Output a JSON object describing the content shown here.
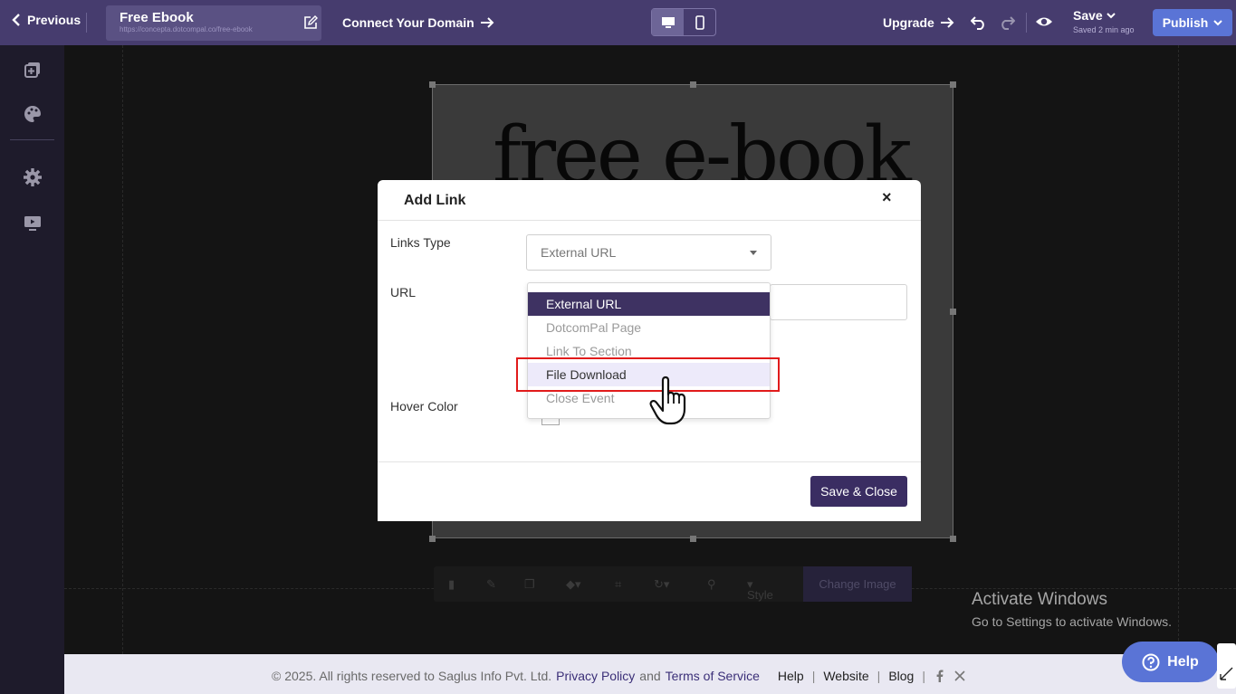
{
  "topbar": {
    "previous_label": "Previous",
    "page_title": "Free Ebook",
    "page_url": "https://concepta.dotcompal.co/free-ebook",
    "connect_domain": "Connect Your Domain",
    "upgrade": "Upgrade",
    "save": "Save",
    "saved_ago": "Saved 2 min ago",
    "publish": "Publish",
    "device_active": "desktop"
  },
  "sidebar": {
    "items": [
      "pages-icon",
      "palette-icon",
      "gear-icon",
      "preview-monitor-icon"
    ]
  },
  "canvas": {
    "image_headline": "free e-book",
    "toolbar": {
      "style_label": "Style",
      "change_image_label": "Change Image"
    }
  },
  "modal": {
    "title": "Add Link",
    "close": "×",
    "links_type_label": "Links Type",
    "links_type_value": "External URL",
    "url_label": "URL",
    "hover_color_label": "Hover Color",
    "save_close": "Save & Close"
  },
  "dropdown": {
    "options": [
      "External URL",
      "DotcomPal Page",
      "Link To Section",
      "File Download",
      "Close Event"
    ],
    "selected": "External URL",
    "hovered": "File Download"
  },
  "watermark": {
    "line1": "Activate Windows",
    "line2": "Go to Settings to activate Windows."
  },
  "footer": {
    "copyright": "©  2025. All rights reserved to Saglus Info Pvt. Ltd.",
    "privacy": "Privacy Policy",
    "and": "and",
    "terms": "Terms of Service",
    "help": "Help",
    "website": "Website",
    "blog": "Blog",
    "pipe": "|"
  },
  "help_button": "Help",
  "colors": {
    "topbar": "#463c6e",
    "accent_blue": "#5a74d6",
    "modal_primary": "#3a2d62",
    "highlight_red": "#e11b1b"
  }
}
